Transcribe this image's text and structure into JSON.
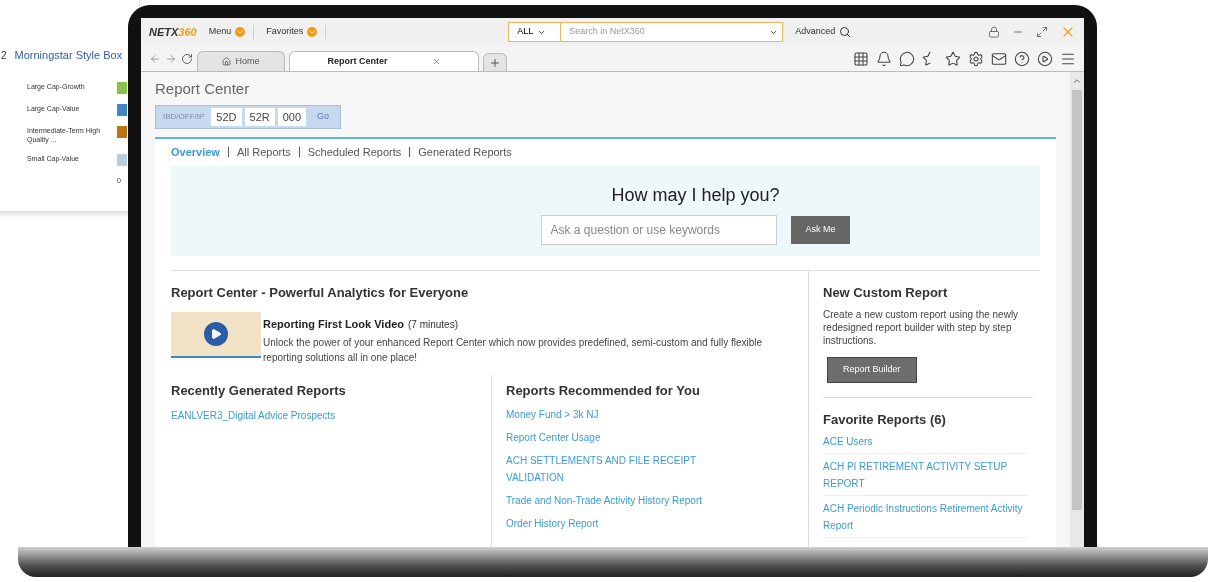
{
  "background_card": {
    "number": "2",
    "title": "Morningstar Style Box",
    "legend": [
      {
        "label": "Large Cap-Growth",
        "color": "#8bc34a"
      },
      {
        "label": "Large Cap-Value",
        "color": "#3f88c5"
      },
      {
        "label": "Intermediate-Term High Quality ...",
        "color": "#c0730f"
      },
      {
        "label": "Small Cap-Value",
        "color": "#b8cde0"
      }
    ],
    "axis_label": "0"
  },
  "app_header": {
    "logo": {
      "prefix": "NETX",
      "suffix": "360"
    },
    "menus": [
      {
        "label": "Menu"
      },
      {
        "label": "Favorites"
      }
    ],
    "search": {
      "scope": "ALL",
      "placeholder": "Search in NetX360"
    },
    "advanced": "Advanced"
  },
  "tabs": [
    {
      "label": "Home",
      "kind": "home",
      "selected": false
    },
    {
      "label": "Report Center",
      "kind": "page",
      "selected": true
    }
  ],
  "page": {
    "title": "Report Center",
    "selector": {
      "label": "IBD/OFF/IP",
      "values": [
        "52D",
        "52R",
        "000"
      ],
      "button": "Go"
    },
    "subnav": [
      {
        "label": "Overview",
        "selected": true
      },
      {
        "label": "All Reports",
        "selected": false
      },
      {
        "label": "Scheduled Reports",
        "selected": false
      },
      {
        "label": "Generated Reports",
        "selected": false
      }
    ],
    "help": {
      "heading": "How may I help you?",
      "placeholder": "Ask a question or use keywords",
      "button": "Ask Me"
    },
    "intro": {
      "heading": "Report Center - Powerful Analytics for Everyone",
      "video_title": "Reporting First Look Video",
      "video_duration": "(7 minutes)",
      "description": "Unlock the power of your enhanced Report Center which now provides predefined, semi-custom and fully flexible reporting solutions all in one place!"
    },
    "recent": {
      "heading": "Recently Generated Reports",
      "items": [
        "EANLVER3_Digital Advice Prospects"
      ]
    },
    "recommended": {
      "heading": "Reports Recommended for You",
      "items": [
        "Money Fund > 3k NJ",
        "Report Center Usage",
        "ACH SETTLEMENTS AND FILE RECEIPT VALIDATION",
        "Trade and Non-Trade Activity History Report",
        "Order History Report"
      ]
    },
    "custom": {
      "heading": "New Custom Report",
      "description": "Create a new custom report using the newly redesigned report builder with step by step instructions.",
      "button": "Report Builder"
    },
    "favorites": {
      "heading": "Favorite Reports (6)",
      "items": [
        "ACE Users",
        "ACH PI RETIREMENT ACTIVITY SETUP REPORT",
        "ACH Periodic Instructions Retirement Activity Report"
      ]
    }
  }
}
